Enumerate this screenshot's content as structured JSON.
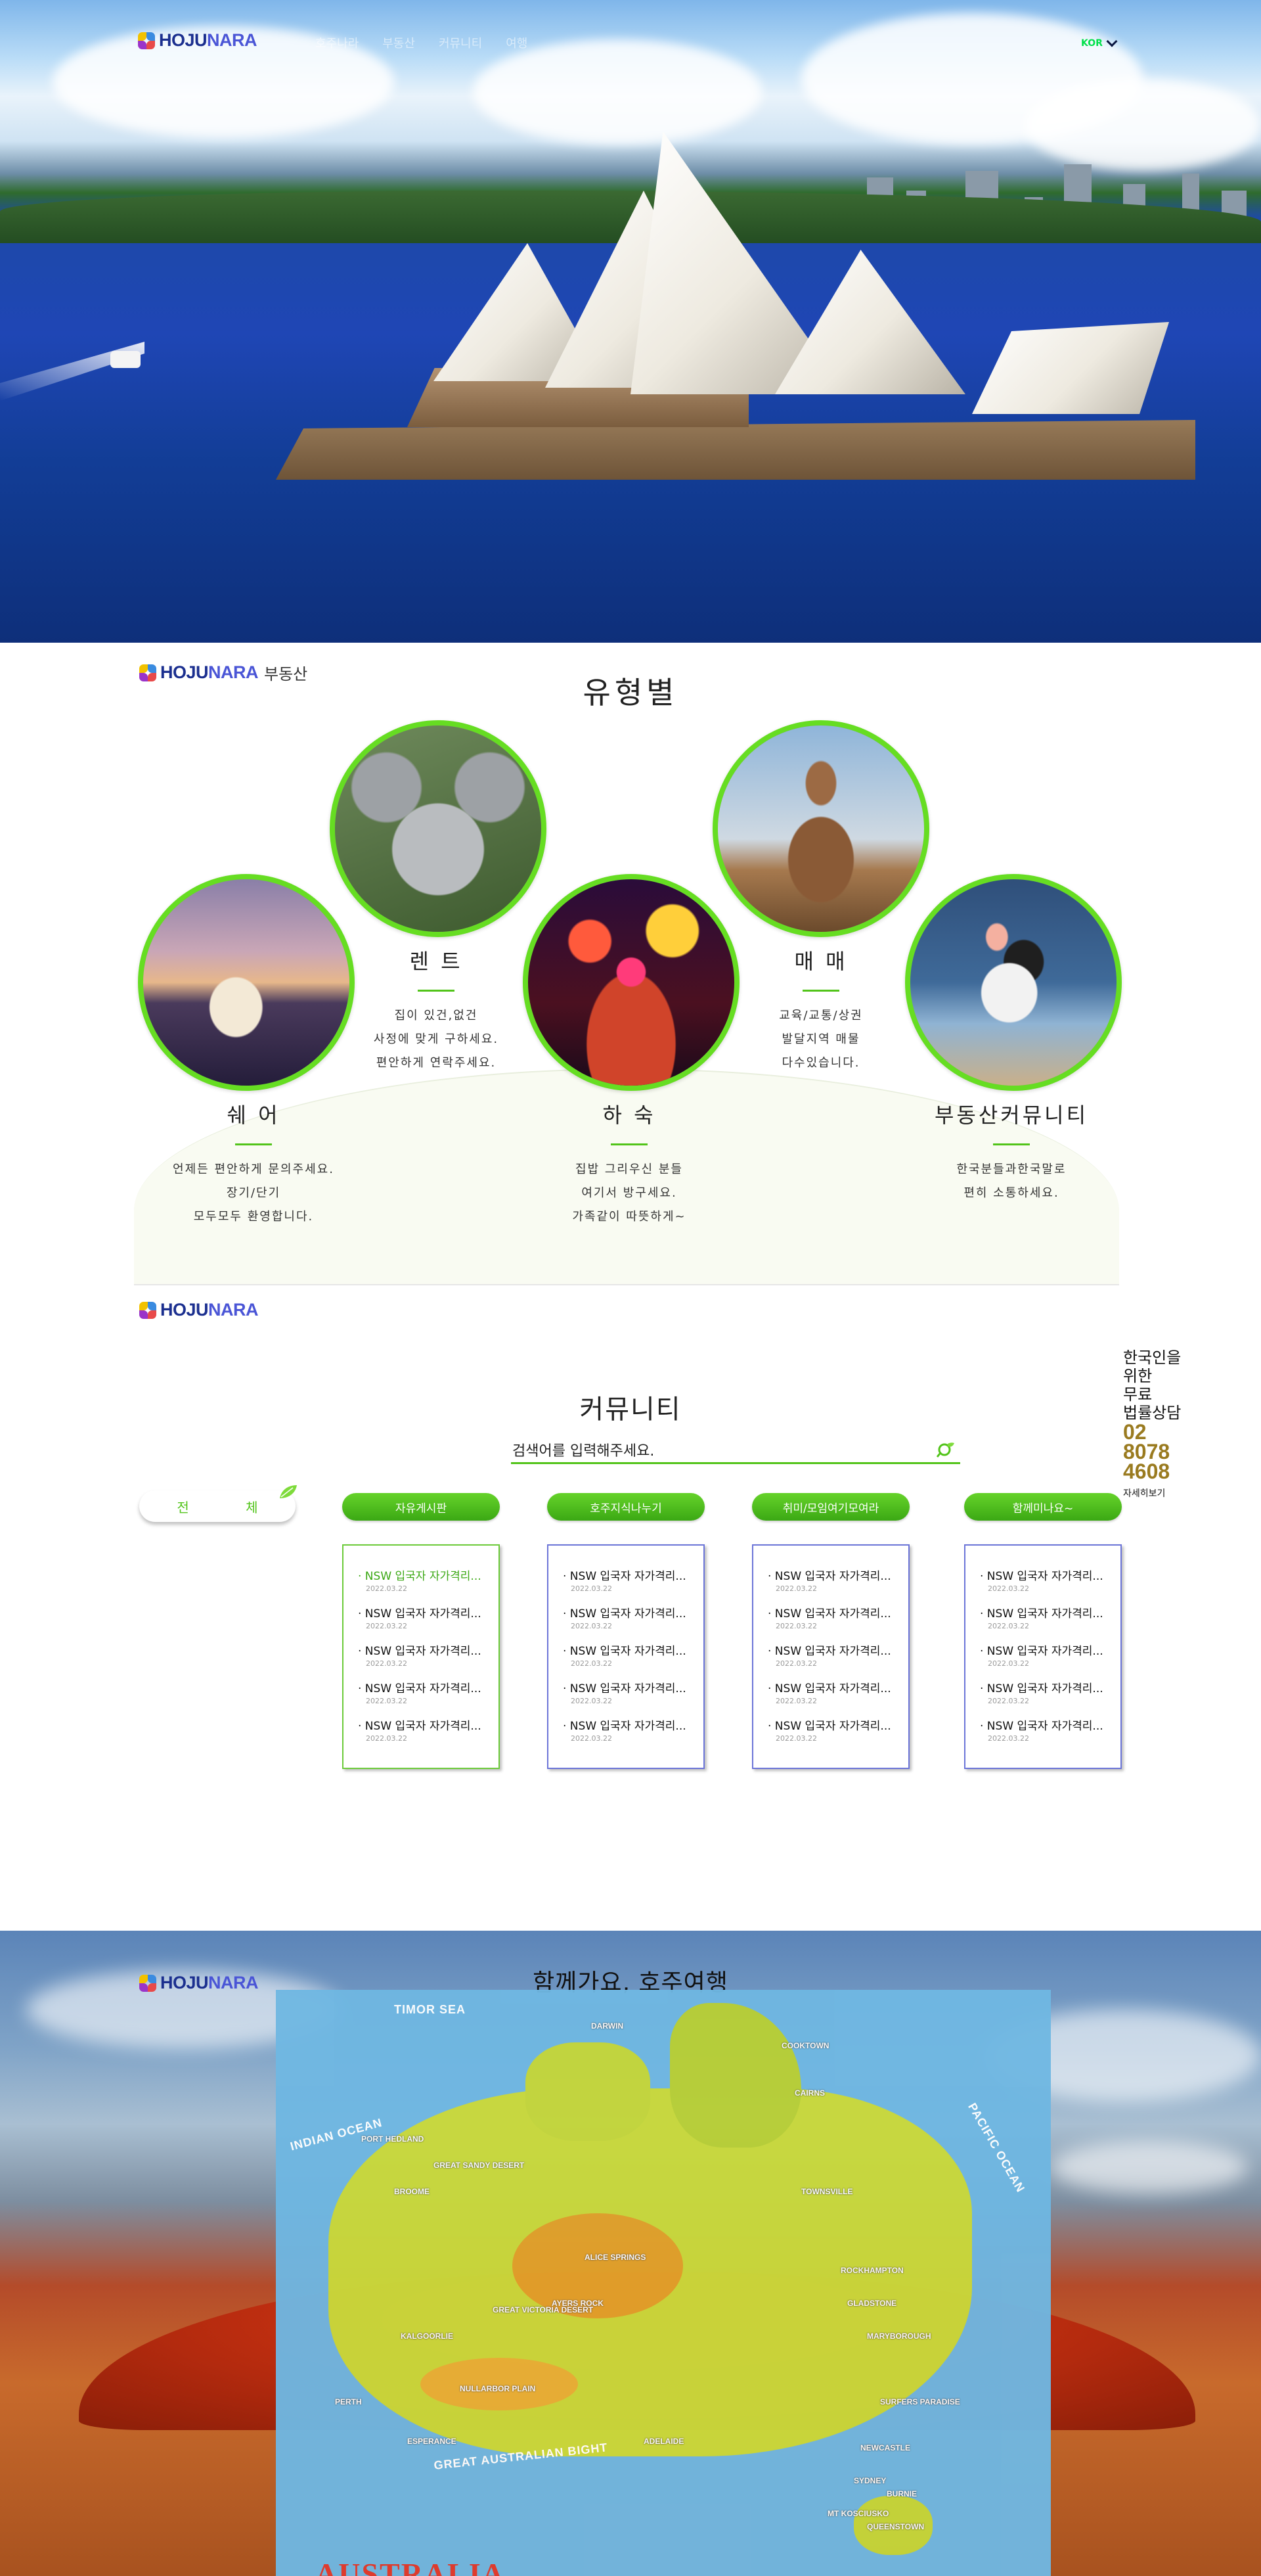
{
  "header": {
    "logo": {
      "part1": "HOJU",
      "part2": "NARA"
    },
    "nav": [
      "호주나라",
      "부동산",
      "커뮤니티",
      "여행"
    ],
    "language": "KOR"
  },
  "types": {
    "subtitle": "부동산",
    "title": "유형별",
    "cards": [
      {
        "title": "렌 트",
        "desc": [
          "집이 있건,없건",
          "사정에 맞게 구하세요.",
          "편안하게 연락주세요."
        ]
      },
      {
        "title": "매 매",
        "desc": [
          "교육/교통/상권",
          "발달지역 매물",
          "다수있습니다."
        ]
      },
      {
        "title": "쉐 어",
        "desc": [
          "언제든 편안하게 문의주세요.",
          "장기/단기",
          "모두모두 환영합니다."
        ]
      },
      {
        "title": "하 숙",
        "desc": [
          "집밥 그리우신 분들",
          "여기서 방구세요.",
          "가족같이 따뜻하게~"
        ]
      },
      {
        "title": "부동산커뮤니티",
        "desc": [
          "한국분들과한국말로",
          "편히 소통하세요."
        ]
      }
    ]
  },
  "community": {
    "title": "커뮤니티",
    "search_placeholder": "검색어를 입력해주세요.",
    "all_label": "전 체",
    "legal": {
      "lines": [
        "한국인을",
        "위한",
        "무료",
        "법률상담"
      ],
      "phone": [
        "02",
        "8078",
        "4608"
      ],
      "more": "자세히보기"
    },
    "colors": {
      "accent": "#52c41a"
    },
    "boards": [
      {
        "tab": "자유게시판",
        "border": "#6ccb3a",
        "posts": [
          {
            "title": "· NSW 입국자 자가격리...",
            "date": "2022.03.22",
            "highlight": true
          },
          {
            "title": "· NSW 입국자 자가격리...",
            "date": "2022.03.22",
            "highlight": false
          },
          {
            "title": "· NSW 입국자 자가격리...",
            "date": "2022.03.22",
            "highlight": false
          },
          {
            "title": "· NSW 입국자 자가격리...",
            "date": "2022.03.22",
            "highlight": false
          },
          {
            "title": "· NSW 입국자 자가격리...",
            "date": "2022.03.22",
            "highlight": false
          }
        ]
      },
      {
        "tab": "호주지식나누기",
        "border": "#6b74d8",
        "posts": [
          {
            "title": "· NSW 입국자 자가격리...",
            "date": "2022.03.22",
            "highlight": false
          },
          {
            "title": "· NSW 입국자 자가격리...",
            "date": "2022.03.22",
            "highlight": false
          },
          {
            "title": "· NSW 입국자 자가격리...",
            "date": "2022.03.22",
            "highlight": false
          },
          {
            "title": "· NSW 입국자 자가격리...",
            "date": "2022.03.22",
            "highlight": false
          },
          {
            "title": "· NSW 입국자 자가격리...",
            "date": "2022.03.22",
            "highlight": false
          }
        ]
      },
      {
        "tab": "취미/모임여기모여라",
        "border": "#6b74d8",
        "posts": [
          {
            "title": "· NSW 입국자 자가격리...",
            "date": "2022.03.22",
            "highlight": false
          },
          {
            "title": "· NSW 입국자 자가격리...",
            "date": "2022.03.22",
            "highlight": false
          },
          {
            "title": "· NSW 입국자 자가격리...",
            "date": "2022.03.22",
            "highlight": false
          },
          {
            "title": "· NSW 입국자 자가격리...",
            "date": "2022.03.22",
            "highlight": false
          },
          {
            "title": "· NSW 입국자 자가격리...",
            "date": "2022.03.22",
            "highlight": false
          }
        ]
      },
      {
        "tab": "함께미나요~",
        "border": "#6b74d8",
        "posts": [
          {
            "title": "· NSW 입국자 자가격리...",
            "date": "2022.03.22",
            "highlight": false
          },
          {
            "title": "· NSW 입국자 자가격리...",
            "date": "2022.03.22",
            "highlight": false
          },
          {
            "title": "· NSW 입국자 자가격리...",
            "date": "2022.03.22",
            "highlight": false
          },
          {
            "title": "· NSW 입국자 자가격리...",
            "date": "2022.03.22",
            "highlight": false
          },
          {
            "title": "· NSW 입국자 자가격리...",
            "date": "2022.03.22",
            "highlight": false
          }
        ]
      }
    ]
  },
  "travel": {
    "title": "함께가요, 호주여행",
    "map_labels": [
      "TIMOR SEA",
      "INDIAN OCEAN",
      "PACIFIC OCEAN",
      "GREAT AUSTRALIAN BIGHT",
      "AUSTRALIA"
    ],
    "cities": [
      "DARWIN",
      "CAIRNS",
      "COOKTOWN",
      "TOWNSVILLE",
      "ROCKHAMPTON",
      "GLADSTONE",
      "MARYBOROUGH",
      "SURFERS PARADISE",
      "NEWCASTLE",
      "SYDNEY",
      "PERTH",
      "ADELAIDE",
      "KALGOORLIE",
      "BROOME",
      "ALICE SPRINGS",
      "AYERS ROCK",
      "ESPERANCE",
      "MT KOSCIUSKO",
      "BURNIE",
      "QUEENSTOWN",
      "PORT HEDLAND",
      "GREAT SANDY DESERT",
      "NULLARBOR PLAIN",
      "GREAT VICTORIA DESERT"
    ]
  }
}
